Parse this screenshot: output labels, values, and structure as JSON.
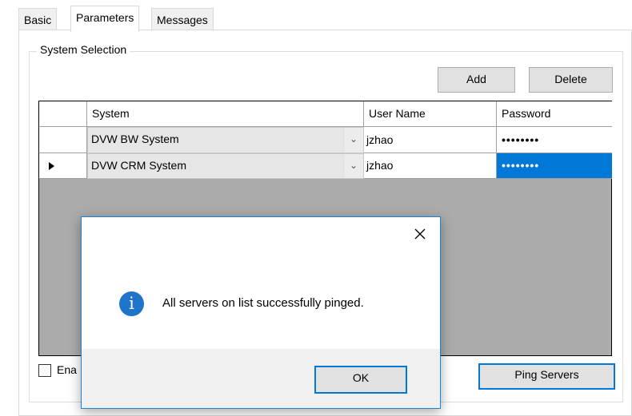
{
  "tabs": [
    {
      "label": "Basic"
    },
    {
      "label": "Parameters"
    },
    {
      "label": "Messages"
    }
  ],
  "group": {
    "title": "System Selection"
  },
  "toolbar": {
    "add_label": "Add",
    "delete_label": "Delete"
  },
  "grid": {
    "columns": [
      "System",
      "User Name",
      "Password"
    ],
    "rows": [
      {
        "system": "DVW BW System",
        "user": "jzhao",
        "password": "••••••••"
      },
      {
        "system": "DVW CRM System",
        "user": "jzhao",
        "password": "••••••••"
      }
    ]
  },
  "checkbox": {
    "label": "Ena"
  },
  "ping_button": {
    "label": "Ping Servers"
  },
  "dialog": {
    "message": "All servers on list successfully pinged.",
    "ok_label": "OK",
    "icon": "info-icon"
  },
  "colors": {
    "selection": "#0078d7",
    "grid_background": "#ababab",
    "info_icon": "#1e74c9"
  }
}
